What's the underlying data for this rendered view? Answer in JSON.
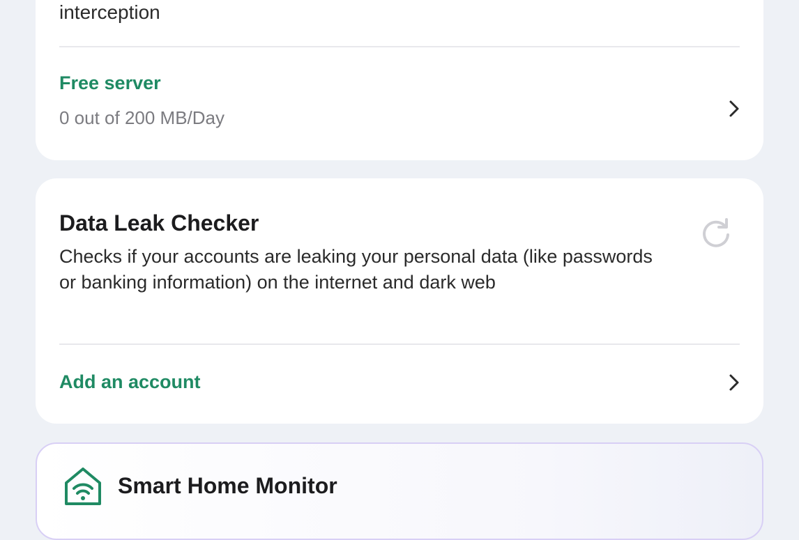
{
  "vpn_card": {
    "partial_text": "interception",
    "free_server_label": "Free server",
    "free_server_usage": "0 out of 200 MB/Day"
  },
  "data_leak_card": {
    "title": "Data Leak Checker",
    "description": "Checks if your accounts are leaking your personal data (like passwords or banking information) on the internet and dark web",
    "action_label": "Add an account"
  },
  "smart_home_card": {
    "title": "Smart Home Monitor"
  },
  "icons": {
    "chevron": "chevron-right-icon",
    "refresh": "refresh-icon",
    "house": "smart-home-wifi-icon"
  },
  "colors": {
    "accent": "#1f8a63",
    "background": "#eef1f6",
    "card": "#ffffff"
  }
}
